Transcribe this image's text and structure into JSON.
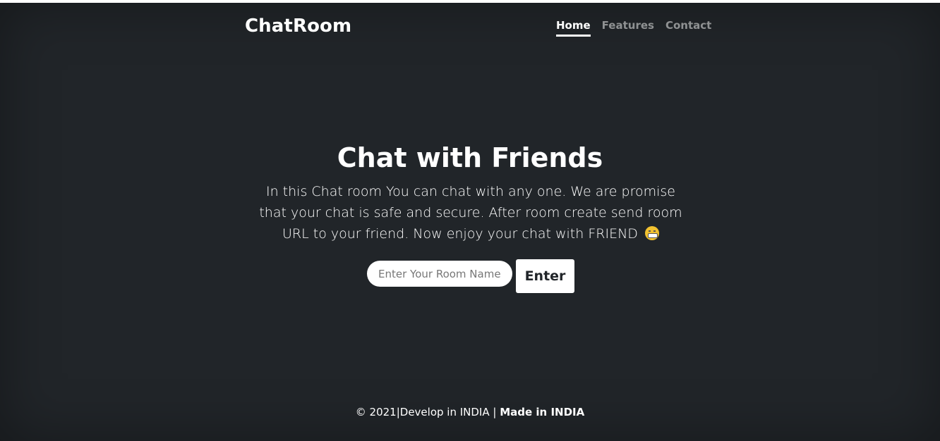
{
  "header": {
    "brand": "ChatRoom",
    "nav": [
      {
        "label": "Home",
        "active": true
      },
      {
        "label": "Features",
        "active": false
      },
      {
        "label": "Contact",
        "active": false
      }
    ]
  },
  "hero": {
    "title": "Chat with Friends",
    "lead": "In this Chat room You can chat with any one. We are promise that your chat is safe and secure. After room create send room URL to your friend. Now enjoy your chat with FRIEND",
    "emoji_icon": "grinning-face-icon"
  },
  "form": {
    "input_placeholder": "Enter Your Room Name",
    "input_value": "",
    "button_label": "Enter"
  },
  "footer": {
    "text": "© 2021|Develop in INDIA | ",
    "strong": "Made in INDIA"
  },
  "colors": {
    "background": "#212529",
    "text": "#ffffff",
    "nav_inactive": "rgba(255,255,255,0.5)"
  }
}
